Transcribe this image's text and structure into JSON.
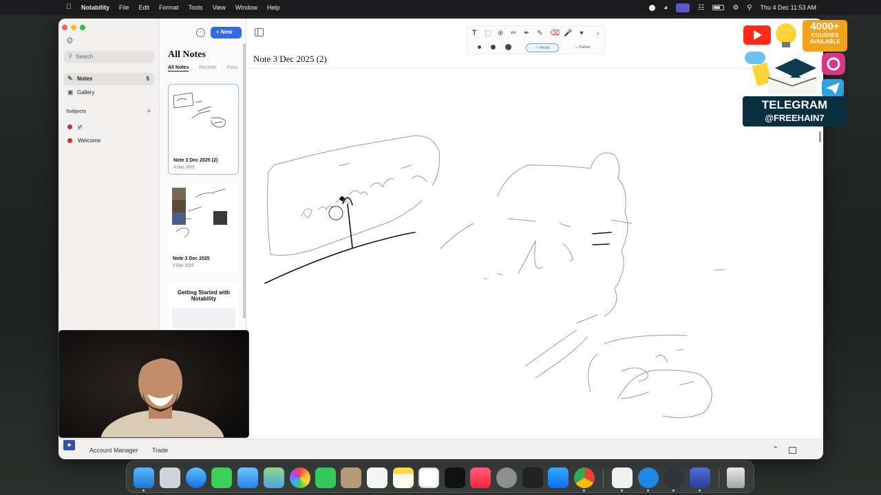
{
  "menubar": {
    "apple": "",
    "app_name": "Notability",
    "menus": [
      "File",
      "Edit",
      "Format",
      "Tools",
      "View",
      "Window",
      "Help"
    ],
    "clock": "Thu 4 Dec  11:53 AM"
  },
  "sidebar": {
    "search_placeholder": "Search",
    "items": [
      {
        "label": "Notes",
        "count": "5"
      },
      {
        "label": "Gallery"
      }
    ],
    "subjects_header": "Subjects",
    "subjects": [
      {
        "label": "yt",
        "color": "#d02a38"
      },
      {
        "label": "Welcome",
        "color": "#d02a38"
      }
    ]
  },
  "notes_list": {
    "new_label": "New",
    "title": "All Notes",
    "tabs": [
      "All Notes",
      "Recents",
      "Favo"
    ],
    "notes": [
      {
        "title": "Note 3 Dec 2025 (2)",
        "date": "4 Dec 2025"
      },
      {
        "title": "Note 3 Dec 2025",
        "date": "3 Dec 2025"
      },
      {
        "title": "Getting Started with Notability"
      }
    ]
  },
  "toolbar": {
    "segment_whole": "Whole",
    "segment_partial": "Partial"
  },
  "note": {
    "title": "Note 3 Dec 2025 (2)"
  },
  "bottom_bar": {
    "account_manager": "Account Manager",
    "trade": "Trade"
  },
  "promo": {
    "badge_count": "4000+",
    "badge_line2": "COURSES",
    "badge_line3": "AVAILABLE",
    "line1": "TELEGRAM",
    "line2": "@FREEHAIN7"
  },
  "dock": {
    "apps": [
      "Finder",
      "Launchpad",
      "Safari",
      "Messages",
      "Mail",
      "Maps",
      "Photos",
      "FaceTime",
      "Contacts",
      "Reminders",
      "Notes",
      "Freeform",
      "TV",
      "Music",
      "System Settings",
      "Keychain",
      "App Store",
      "Chrome",
      "Word",
      "Quick",
      "OBS",
      "Notability",
      "Trash"
    ]
  },
  "colors": {
    "accent": "#2f6ce5",
    "subject_dot": "#d02a38",
    "promo_orange": "#f3a21b"
  }
}
